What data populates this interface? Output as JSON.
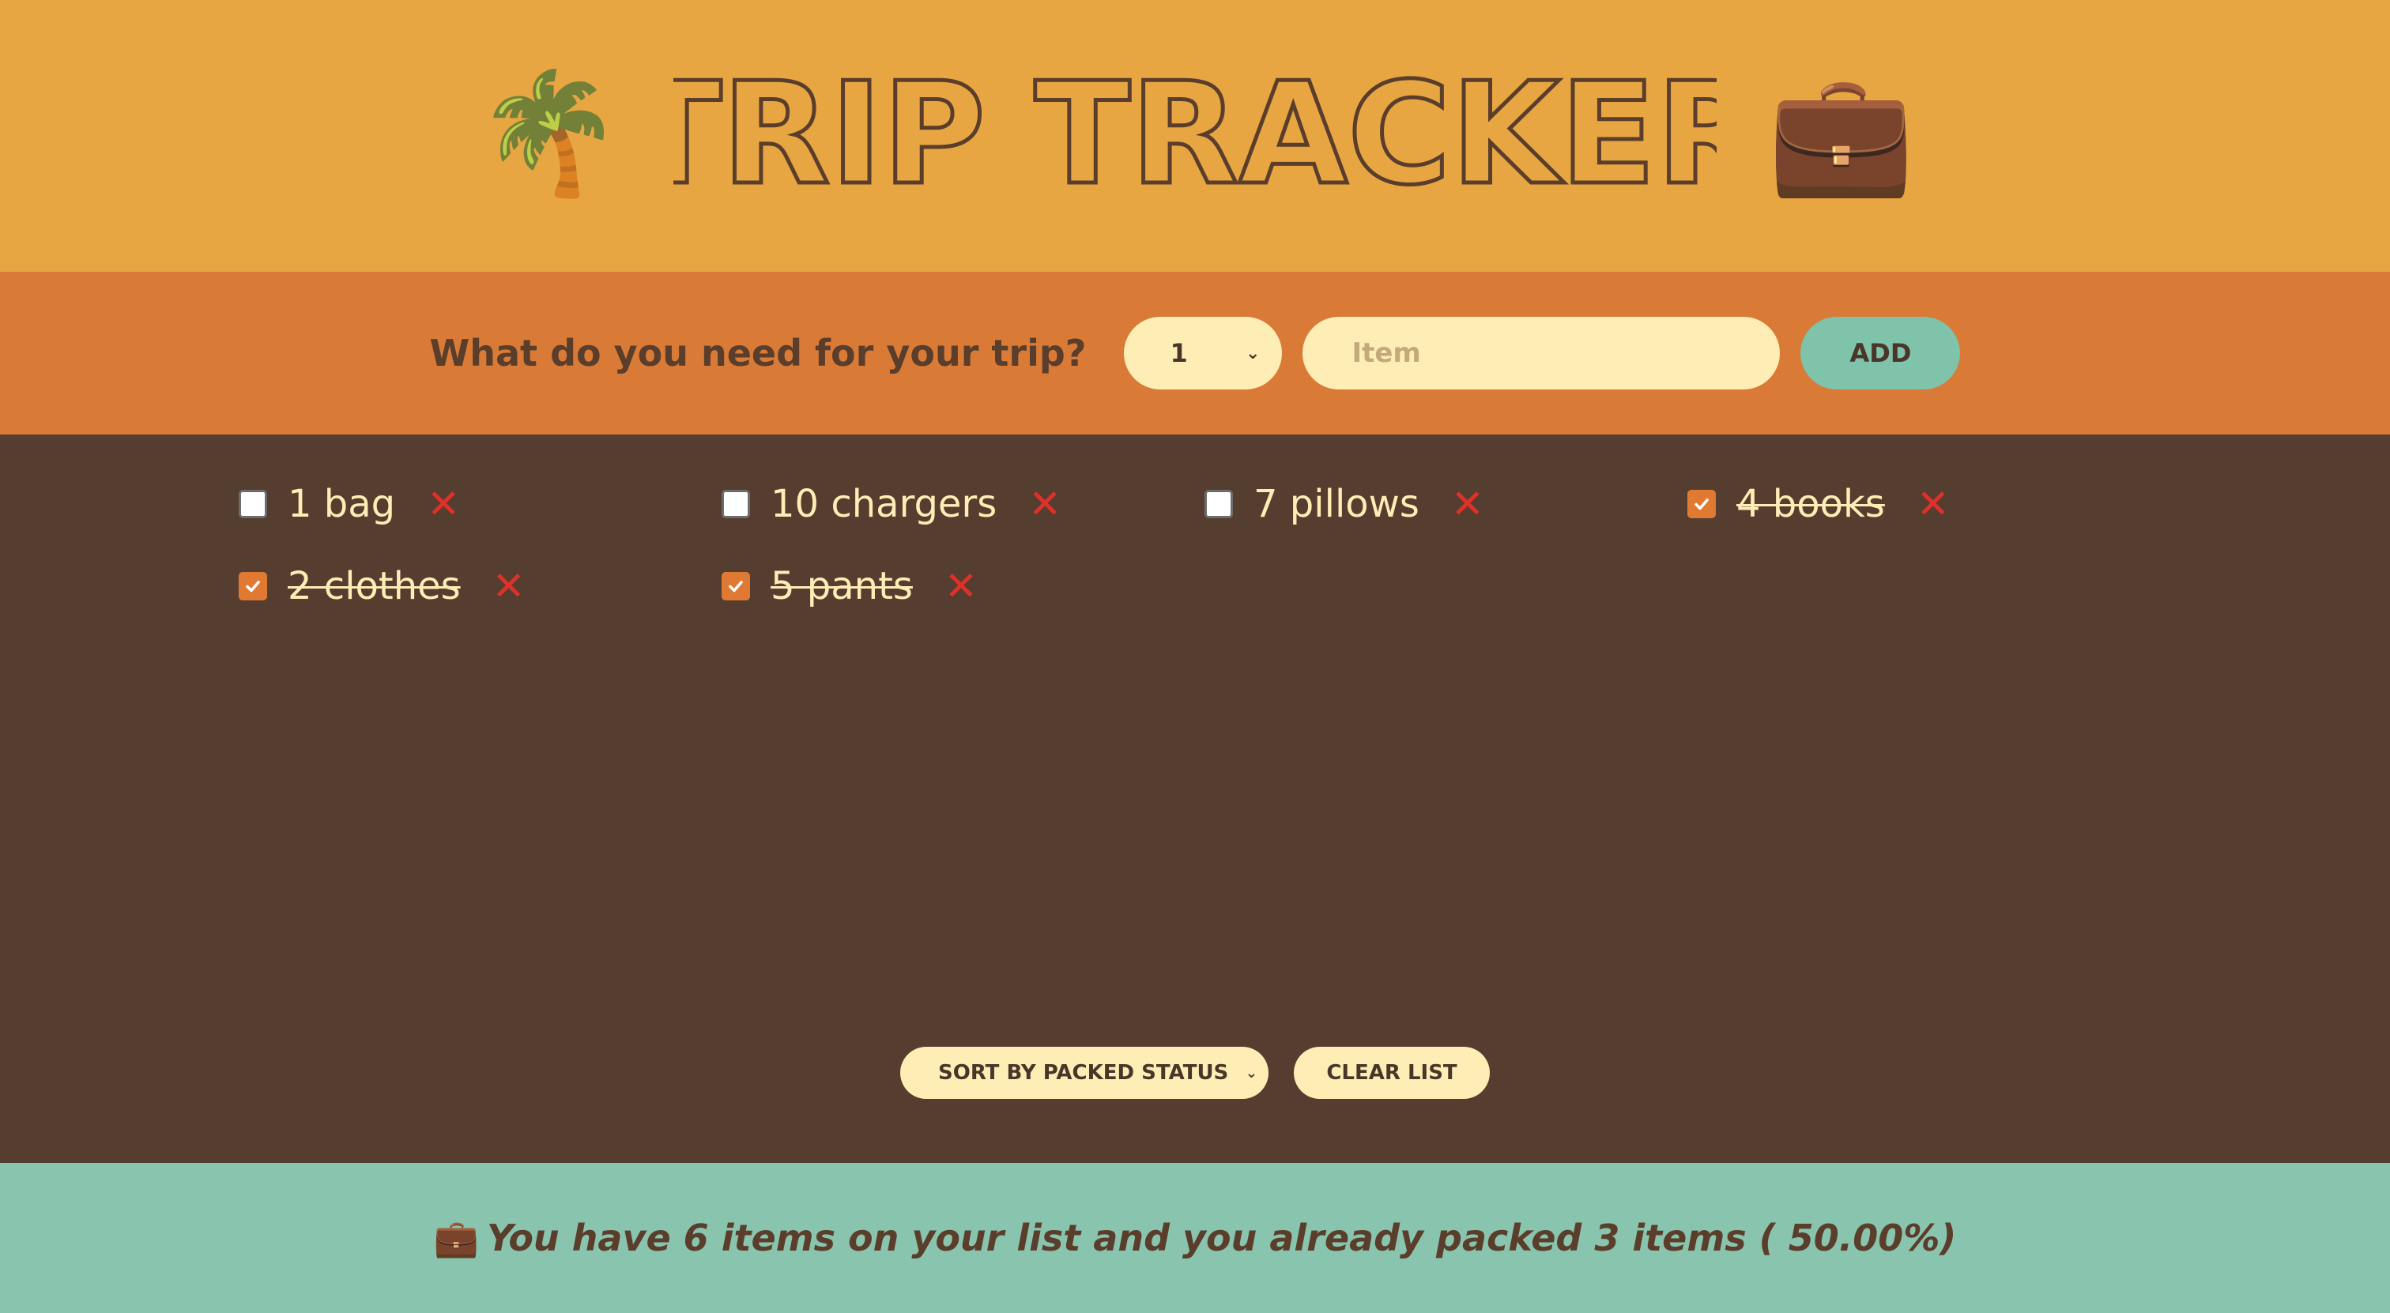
{
  "header": {
    "title": "TRIP TRACKER",
    "left_icon": "palm-tree-icon",
    "left_emoji": "🌴",
    "right_icon": "briefcase-icon",
    "right_emoji": "💼"
  },
  "form": {
    "question": "What do you need for your trip?",
    "quantity_value": "1",
    "item_placeholder": "Item",
    "item_value": "",
    "add_label": "ADD"
  },
  "items": [
    {
      "label": "1 bag",
      "packed": false
    },
    {
      "label": "10 chargers",
      "packed": false
    },
    {
      "label": "7 pillows",
      "packed": false
    },
    {
      "label": "4 books",
      "packed": true
    },
    {
      "label": "2 clothes",
      "packed": true
    },
    {
      "label": "5 pants",
      "packed": true
    }
  ],
  "actions": {
    "sort_value": "SORT BY PACKED STATUS",
    "clear_label": "CLEAR LIST"
  },
  "footer": {
    "icon": "briefcase-icon",
    "emoji": "💼",
    "text": "You have 6 items on your list and you already packed 3 items ( 50.00%)"
  },
  "colors": {
    "header_bg": "#E8A643",
    "form_bg": "#D97A37",
    "list_bg": "#553D2F",
    "footer_bg": "#89C4AE",
    "cream": "#FEEDB5",
    "teal_button": "#7EC3AA",
    "delete_red": "#E0302A",
    "checked_orange": "#E07A33",
    "title_brown": "#5A3E2B"
  }
}
